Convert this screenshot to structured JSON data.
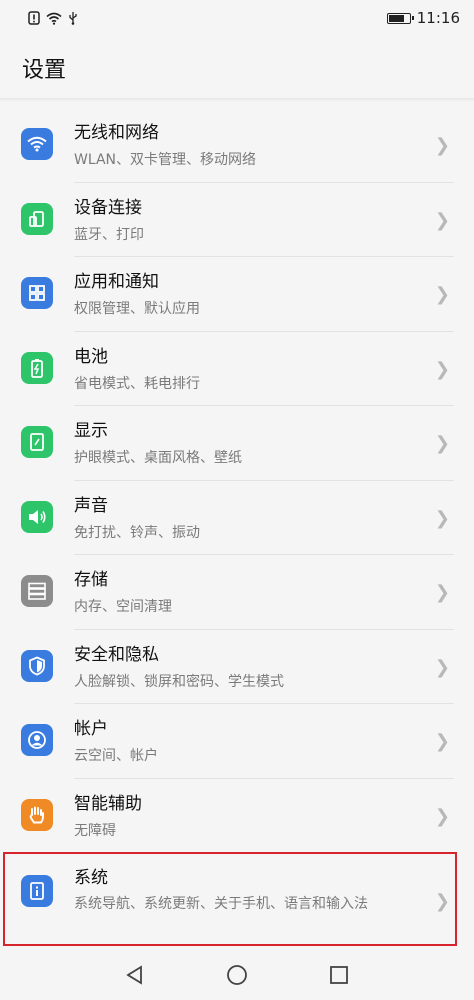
{
  "status": {
    "time": "11:16",
    "icons": [
      "alert-icon",
      "wifi-icon",
      "usb-icon"
    ]
  },
  "header": {
    "title": "设置"
  },
  "items": [
    {
      "id": "wlan",
      "name": "无线和网络",
      "sub": "WLAN、双卡管理、移动网络",
      "icon": "wifi-icon",
      "color": "#3a7be0"
    },
    {
      "id": "device",
      "name": "设备连接",
      "sub": "蓝牙、打印",
      "icon": "device-connect-icon",
      "color": "#2ec56a"
    },
    {
      "id": "apps",
      "name": "应用和通知",
      "sub": "权限管理、默认应用",
      "icon": "apps-grid-icon",
      "color": "#3a7be0"
    },
    {
      "id": "battery",
      "name": "电池",
      "sub": "省电模式、耗电排行",
      "icon": "battery-icon",
      "color": "#2ec56a"
    },
    {
      "id": "display",
      "name": "显示",
      "sub": "护眼模式、桌面风格、壁纸",
      "icon": "display-icon",
      "color": "#2ec56a"
    },
    {
      "id": "sound",
      "name": "声音",
      "sub": "免打扰、铃声、振动",
      "icon": "sound-icon",
      "color": "#2ec56a"
    },
    {
      "id": "storage",
      "name": "存储",
      "sub": "内存、空间清理",
      "icon": "storage-icon",
      "color": "#8c8c8c"
    },
    {
      "id": "security",
      "name": "安全和隐私",
      "sub": "人脸解锁、锁屏和密码、学生模式",
      "icon": "shield-icon",
      "color": "#3a7be0"
    },
    {
      "id": "account",
      "name": "帐户",
      "sub": "云空间、帐户",
      "icon": "account-icon",
      "color": "#3a7be0"
    },
    {
      "id": "accessibility",
      "name": "智能辅助",
      "sub": "无障碍",
      "icon": "hand-icon",
      "color": "#f08a24"
    },
    {
      "id": "system",
      "name": "系统",
      "sub": "系统导航、系统更新、关于手机、语言和输入法",
      "icon": "info-icon",
      "color": "#3a7be0"
    }
  ],
  "nav": {
    "buttons": [
      "back-icon",
      "home-icon",
      "recents-icon"
    ]
  }
}
